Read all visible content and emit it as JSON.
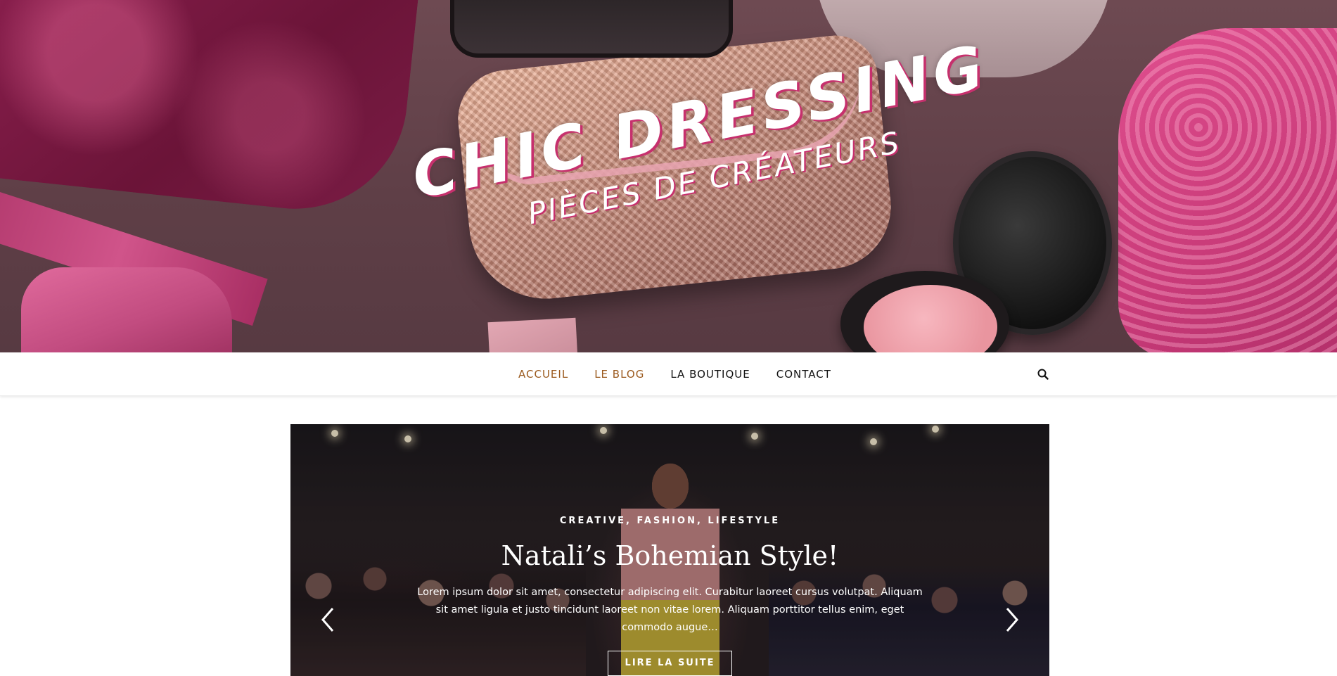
{
  "header": {
    "site_title": "CHIC DRESSING",
    "tagline": "PIÈCES DE CRÉATEURS"
  },
  "nav": {
    "items": [
      {
        "label": "ACCUEIL",
        "active": true
      },
      {
        "label": "LE BLOG",
        "active": true
      },
      {
        "label": "LA BOUTIQUE",
        "active": false
      },
      {
        "label": "CONTACT",
        "active": false
      }
    ],
    "search_icon": "search-icon",
    "active_color": "#9b5a1e"
  },
  "slider": {
    "categories": "CREATIVE, FASHION, LIFESTYLE",
    "title": "Natali’s Bohemian Style!",
    "excerpt": "Lorem ipsum dolor sit amet, consectetur adipiscing elit. Curabitur laoreet cursus volutpat. Aliquam sit amet ligula et justo tincidunt laoreet non vitae lorem. Aliquam porttitor tellus enim, eget commodo augue…",
    "button_label": "LIRE LA SUITE",
    "prev_icon": "chevron-left-icon",
    "next_icon": "chevron-right-icon"
  }
}
